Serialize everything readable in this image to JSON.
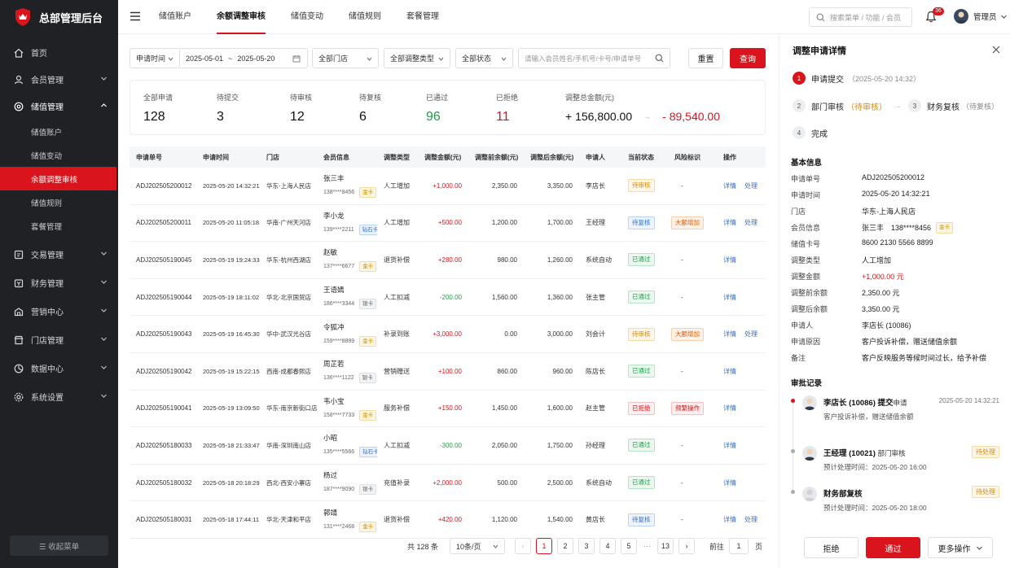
{
  "app": {
    "title": "总部管理后台"
  },
  "sidebar": {
    "items": [
      {
        "label": "首页",
        "icon": "home-icon"
      },
      {
        "label": "会员管理",
        "icon": "user-icon"
      },
      {
        "label": "储值管理",
        "icon": "wallet-icon"
      },
      {
        "label": "交易管理",
        "icon": "receipt-icon"
      },
      {
        "label": "财务管理",
        "icon": "finance-icon"
      },
      {
        "label": "营销中心",
        "icon": "marketing-icon"
      },
      {
        "label": "门店管理",
        "icon": "store-icon"
      },
      {
        "label": "数据中心",
        "icon": "chart-icon"
      },
      {
        "label": "系统设置",
        "icon": "gear-icon"
      }
    ],
    "sub_items": [
      "储值账户",
      "储值变动",
      "余额调整审核",
      "储值规则",
      "套餐管理"
    ],
    "collapse_label": "☰ 收起菜单"
  },
  "topbar": {
    "tabs": [
      "储值账户",
      "余额调整审核",
      "储值变动",
      "储值规则",
      "套餐管理"
    ],
    "search_placeholder": "搜索菜单 / 功能 / 会员",
    "notification_count": "36",
    "user_name": "管理员"
  },
  "filters": {
    "time_type": "申请时间",
    "date_start": "2025-05-01",
    "date_sep": "~",
    "date_end": "2025-05-20",
    "store": "全部门店",
    "adjust_type": "全部调整类型",
    "status": "全部状态",
    "keyword_placeholder": "请输入会员姓名/手机号/卡号/申请单号",
    "reset_label": "重置",
    "query_label": "查询"
  },
  "stats": {
    "total": {
      "label": "全部申请",
      "value": "128"
    },
    "to_submit": {
      "label": "待提交",
      "value": "3"
    },
    "to_review": {
      "label": "待审核",
      "value": "12"
    },
    "to_recheck": {
      "label": "待复核",
      "value": "6"
    },
    "passed": {
      "label": "已通过",
      "value": "96"
    },
    "rejected": {
      "label": "已拒绝",
      "value": "11"
    },
    "amount": {
      "label": "调整总金额(元)",
      "plus": "+ 156,800.00",
      "arrow": "→",
      "minus": "- 89,540.00"
    }
  },
  "table": {
    "headers": [
      "申请单号",
      "申请时间",
      "门店",
      "会员信息",
      "调整类型",
      "调整金额(元)",
      "调整前余额(元)",
      "调整后余额(元)",
      "申请人",
      "当前状态",
      "风险标识",
      "操作"
    ],
    "rows": [
      {
        "no": "ADJ202505200012",
        "time": "2025-05-20 14:32:21",
        "store": "华东-上海人民店",
        "name": "张三丰",
        "phone": "138****8456",
        "level": "金卡",
        "type": "人工增加",
        "amount": "+1,000.00",
        "before": "2,350.00",
        "after": "3,350.00",
        "applicant": "李店长",
        "status": "待审核",
        "risk": "-",
        "ops": [
          "详情",
          "处理"
        ]
      },
      {
        "no": "ADJ202505200011",
        "time": "2025-05-20 11:05:18",
        "store": "华南-广州天河店",
        "name": "李小龙",
        "phone": "139****2211",
        "level": "钻石卡",
        "type": "人工增加",
        "amount": "+500.00",
        "before": "1,200.00",
        "after": "1,700.00",
        "applicant": "王经理",
        "status": "待复核",
        "risk": "大额增加",
        "ops": [
          "详情",
          "处理"
        ]
      },
      {
        "no": "ADJ202505190045",
        "time": "2025-05-19 19:24:33",
        "store": "华东-杭州西湖店",
        "name": "赵敏",
        "phone": "137****6677",
        "level": "金卡",
        "type": "退货补偿",
        "amount": "+280.00",
        "before": "980.00",
        "after": "1,260.00",
        "applicant": "系统自动",
        "status": "已通过",
        "risk": "-",
        "ops": [
          "详情"
        ]
      },
      {
        "no": "ADJ202505190044",
        "time": "2025-05-19 18:11:02",
        "store": "华北-北京国贸店",
        "name": "王语嫣",
        "phone": "186****3344",
        "level": "银卡",
        "type": "人工扣减",
        "amount": "-200.00",
        "before": "1,560.00",
        "after": "1,360.00",
        "applicant": "张主管",
        "status": "已通过",
        "risk": "-",
        "ops": [
          "详情"
        ]
      },
      {
        "no": "ADJ202505190043",
        "time": "2025-05-19 16:45:30",
        "store": "华中-武汉光谷店",
        "name": "令狐冲",
        "phone": "159****8899",
        "level": "金卡",
        "type": "补录到账",
        "amount": "+3,000.00",
        "before": "0.00",
        "after": "3,000.00",
        "applicant": "刘会计",
        "status": "待审核",
        "risk": "大额增加",
        "ops": [
          "详情",
          "处理"
        ]
      },
      {
        "no": "ADJ202505190042",
        "time": "2025-05-19 15:22:15",
        "store": "西南-成都春熙店",
        "name": "周芷若",
        "phone": "136****1122",
        "level": "银卡",
        "type": "营销赠送",
        "amount": "+100.00",
        "before": "860.00",
        "after": "960.00",
        "applicant": "陈店长",
        "status": "已通过",
        "risk": "-",
        "ops": [
          "详情"
        ]
      },
      {
        "no": "ADJ202505190041",
        "time": "2025-05-19 13:09:50",
        "store": "华东-南京新街口店",
        "name": "韦小宝",
        "phone": "158****7733",
        "level": "金卡",
        "type": "服务补偿",
        "amount": "+150.00",
        "before": "1,450.00",
        "after": "1,600.00",
        "applicant": "赵主管",
        "status": "已拒绝",
        "risk": "频繁操作",
        "ops": [
          "详情"
        ]
      },
      {
        "no": "ADJ202505180033",
        "time": "2025-05-18 21:33:47",
        "store": "华南-深圳南山店",
        "name": "小昭",
        "phone": "135****5566",
        "level": "钻石卡",
        "type": "人工扣减",
        "amount": "-300.00",
        "before": "2,050.00",
        "after": "1,750.00",
        "applicant": "孙经理",
        "status": "已通过",
        "risk": "-",
        "ops": [
          "详情"
        ]
      },
      {
        "no": "ADJ202505180032",
        "time": "2025-05-18 20:18:29",
        "store": "西北-西安小寨店",
        "name": "杨过",
        "phone": "187****9090",
        "level": "银卡",
        "type": "充值补录",
        "amount": "+2,000.00",
        "before": "500.00",
        "after": "2,500.00",
        "applicant": "系统自动",
        "status": "已通过",
        "risk": "-",
        "ops": [
          "详情"
        ]
      },
      {
        "no": "ADJ202505180031",
        "time": "2025-05-18 17:44:11",
        "store": "华北-天津和平店",
        "name": "郭靖",
        "phone": "131****2468",
        "level": "金卡",
        "type": "退货补偿",
        "amount": "+420.00",
        "before": "1,120.00",
        "after": "1,540.00",
        "applicant": "黄店长",
        "status": "待复核",
        "risk": "-",
        "ops": [
          "详情",
          "处理"
        ]
      }
    ]
  },
  "pager": {
    "total": "共 128 条",
    "page_size": "10条/页",
    "pages": [
      "1",
      "2",
      "3",
      "4",
      "5"
    ],
    "ellipsis": "···",
    "last": "13",
    "goto_label": "前往",
    "goto_value": "1",
    "page_unit": "页"
  },
  "panel": {
    "title": "调整申请详情",
    "steps": [
      {
        "num": "1",
        "label": "申请提交",
        "extra": "（2025-05-20 14:32）"
      },
      {
        "num": "2",
        "label": "部门审核",
        "extra": "（待审核）"
      },
      {
        "num": "3",
        "label": "财务复核",
        "extra": "（待复核）"
      },
      {
        "num": "4",
        "label": "完成",
        "extra": ""
      }
    ],
    "basic_title": "基本信息",
    "basic": [
      {
        "label": "申请单号",
        "value": "ADJ202505200012"
      },
      {
        "label": "申请时间",
        "value": "2025-05-20 14:32:21"
      },
      {
        "label": "门店",
        "value": "华东-上海人民店"
      },
      {
        "label": "会员信息",
        "value": "张三丰　138****8456",
        "tag": "金卡"
      },
      {
        "label": "储值卡号",
        "value": "8600 2130 5566 8899"
      },
      {
        "label": "调整类型",
        "value": "人工增加"
      },
      {
        "label": "调整金额",
        "value": "+1,000.00 元"
      },
      {
        "label": "调整前余额",
        "value": "2,350.00 元"
      },
      {
        "label": "调整后余额",
        "value": "3,350.00 元"
      },
      {
        "label": "申请人",
        "value": "李店长 (10086)"
      },
      {
        "label": "申请原因",
        "value": "客户投诉补偿，赠送储值余额"
      },
      {
        "label": "备注",
        "value": "客户反映服务等候时间过长，给予补偿"
      }
    ],
    "log_title": "审批记录",
    "logs": [
      {
        "name": "李店长 (10086)",
        "action": "提交",
        "action2": "申请",
        "sub": "客户投诉补偿，赠送储值余额",
        "time": "2025-05-20 14:32:21"
      },
      {
        "name": "王经理 (10021)",
        "action": "部门审核",
        "sub": "预计处理时间：2025-05-20 16:00",
        "badge": "待处理"
      },
      {
        "name": "财务部复核",
        "sub": "预计处理时间：2025-05-20 18:00",
        "badge": "待处理"
      }
    ],
    "reject_label": "拒绝",
    "approve_label": "通过",
    "more_label": "更多操作"
  },
  "colors": {
    "brand": "#d9141c",
    "sidebar_bg": "#1f2124",
    "green": "#1e9e4a",
    "blue": "#2f6fd6",
    "orange": "#e08a00"
  }
}
